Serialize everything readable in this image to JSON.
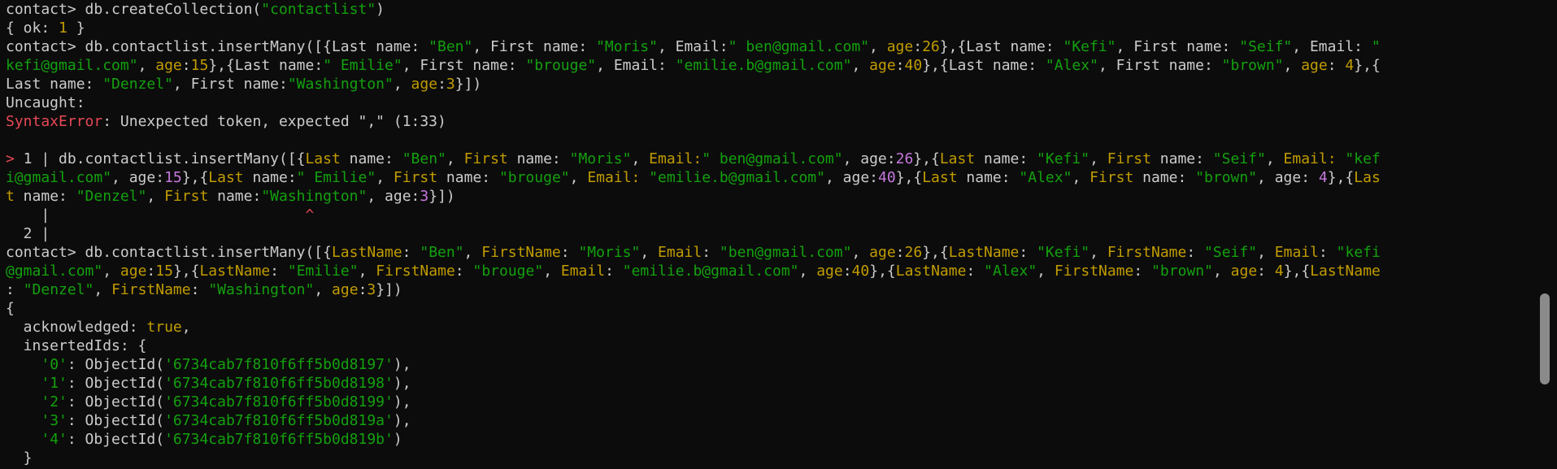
{
  "colors": {
    "background": "#0c0c0c",
    "default": "#cccccc",
    "string": "#13a10e",
    "number": "#c678dd",
    "keyword": "#c19c00",
    "error": "#e74856",
    "scrollbar": "#8a8a8a"
  },
  "lines": [
    [
      {
        "t": "contact> db.createCollection("
      },
      {
        "t": "\"contactlist\"",
        "c": "string"
      },
      {
        "t": ")"
      }
    ],
    [
      {
        "t": "{ ok: "
      },
      {
        "t": "1",
        "c": "keyword"
      },
      {
        "t": " }"
      }
    ],
    [
      {
        "t": "contact> db.contactlist.insertMany([{Last name: "
      },
      {
        "t": "\"Ben\"",
        "c": "string"
      },
      {
        "t": ", First name: "
      },
      {
        "t": "\"Moris\"",
        "c": "string"
      },
      {
        "t": ", Email:"
      },
      {
        "t": "\" ben@gmail.com\"",
        "c": "string"
      },
      {
        "t": ", "
      },
      {
        "t": "age",
        "c": "keyword"
      },
      {
        "t": ":"
      },
      {
        "t": "26",
        "c": "keyword"
      },
      {
        "t": "},{Last name: "
      },
      {
        "t": "\"Kefi\"",
        "c": "string"
      },
      {
        "t": ", First name: "
      },
      {
        "t": "\"Seif\"",
        "c": "string"
      },
      {
        "t": ", Email: "
      },
      {
        "t": "\"",
        "c": "string"
      }
    ],
    [
      {
        "t": "kefi@gmail.com\"",
        "c": "string"
      },
      {
        "t": ", "
      },
      {
        "t": "age",
        "c": "keyword"
      },
      {
        "t": ":"
      },
      {
        "t": "15",
        "c": "keyword"
      },
      {
        "t": "},{Last name:"
      },
      {
        "t": "\" Emilie\"",
        "c": "string"
      },
      {
        "t": ", First name: "
      },
      {
        "t": "\"brouge\"",
        "c": "string"
      },
      {
        "t": ", Email: "
      },
      {
        "t": "\"emilie.b@gmail.com\"",
        "c": "string"
      },
      {
        "t": ", "
      },
      {
        "t": "age",
        "c": "keyword"
      },
      {
        "t": ":"
      },
      {
        "t": "40",
        "c": "keyword"
      },
      {
        "t": "},{Last name: "
      },
      {
        "t": "\"Alex\"",
        "c": "string"
      },
      {
        "t": ", First name: "
      },
      {
        "t": "\"brown\"",
        "c": "string"
      },
      {
        "t": ", "
      },
      {
        "t": "age",
        "c": "keyword"
      },
      {
        "t": ": "
      },
      {
        "t": "4",
        "c": "keyword"
      },
      {
        "t": "},{"
      }
    ],
    [
      {
        "t": "Last name: "
      },
      {
        "t": "\"Denzel\"",
        "c": "string"
      },
      {
        "t": ", First name:"
      },
      {
        "t": "\"Washington\"",
        "c": "string"
      },
      {
        "t": ", "
      },
      {
        "t": "age",
        "c": "keyword"
      },
      {
        "t": ":"
      },
      {
        "t": "3",
        "c": "keyword"
      },
      {
        "t": "}])"
      }
    ],
    [
      {
        "t": "Uncaught:"
      }
    ],
    [
      {
        "t": "SyntaxError",
        "c": "error"
      },
      {
        "t": ": Unexpected token, expected \",\" (1:33)"
      }
    ],
    [],
    [
      {
        "t": ">",
        "c": "error"
      },
      {
        "t": " 1 | db.contactlist.insertMany([{"
      },
      {
        "t": "Last",
        "c": "keyword"
      },
      {
        "t": " name: "
      },
      {
        "t": "\"Ben\"",
        "c": "string"
      },
      {
        "t": ", "
      },
      {
        "t": "First",
        "c": "keyword"
      },
      {
        "t": " name: "
      },
      {
        "t": "\"Moris\"",
        "c": "string"
      },
      {
        "t": ", "
      },
      {
        "t": "Email:",
        "c": "keyword"
      },
      {
        "t": "\" ben@gmail.com\"",
        "c": "string"
      },
      {
        "t": ", age:"
      },
      {
        "t": "26",
        "c": "number"
      },
      {
        "t": "},{"
      },
      {
        "t": "Last",
        "c": "keyword"
      },
      {
        "t": " name: "
      },
      {
        "t": "\"Kefi\"",
        "c": "string"
      },
      {
        "t": ", "
      },
      {
        "t": "First",
        "c": "keyword"
      },
      {
        "t": " name: "
      },
      {
        "t": "\"Seif\"",
        "c": "string"
      },
      {
        "t": ", "
      },
      {
        "t": "Email:",
        "c": "keyword"
      },
      {
        "t": " "
      },
      {
        "t": "\"kef",
        "c": "string"
      }
    ],
    [
      {
        "t": "i@gmail.com\"",
        "c": "string"
      },
      {
        "t": ", age:"
      },
      {
        "t": "15",
        "c": "number"
      },
      {
        "t": "},{"
      },
      {
        "t": "Last",
        "c": "keyword"
      },
      {
        "t": " name:"
      },
      {
        "t": "\" Emilie\"",
        "c": "string"
      },
      {
        "t": ", "
      },
      {
        "t": "First",
        "c": "keyword"
      },
      {
        "t": " name: "
      },
      {
        "t": "\"brouge\"",
        "c": "string"
      },
      {
        "t": ", "
      },
      {
        "t": "Email:",
        "c": "keyword"
      },
      {
        "t": " "
      },
      {
        "t": "\"emilie.b@gmail.com\"",
        "c": "string"
      },
      {
        "t": ", age:"
      },
      {
        "t": "40",
        "c": "number"
      },
      {
        "t": "},{"
      },
      {
        "t": "Last",
        "c": "keyword"
      },
      {
        "t": " name: "
      },
      {
        "t": "\"Alex\"",
        "c": "string"
      },
      {
        "t": ", "
      },
      {
        "t": "First",
        "c": "keyword"
      },
      {
        "t": " name: "
      },
      {
        "t": "\"brown\"",
        "c": "string"
      },
      {
        "t": ", age: "
      },
      {
        "t": "4",
        "c": "number"
      },
      {
        "t": "},{"
      },
      {
        "t": "Las",
        "c": "keyword"
      }
    ],
    [
      {
        "t": "t",
        "c": "keyword"
      },
      {
        "t": " name: "
      },
      {
        "t": "\"Denzel\"",
        "c": "string"
      },
      {
        "t": ", "
      },
      {
        "t": "First",
        "c": "keyword"
      },
      {
        "t": " name:"
      },
      {
        "t": "\"Washington\"",
        "c": "string"
      },
      {
        "t": ", age:"
      },
      {
        "t": "3",
        "c": "number"
      },
      {
        "t": "}])"
      }
    ],
    [
      {
        "t": "    |                             "
      },
      {
        "t": "^",
        "c": "error"
      }
    ],
    [
      {
        "t": "  2 |"
      }
    ],
    [
      {
        "t": "contact> db.contactlist.insertMany([{"
      },
      {
        "t": "LastName",
        "c": "keyword"
      },
      {
        "t": ": "
      },
      {
        "t": "\"Ben\"",
        "c": "string"
      },
      {
        "t": ", "
      },
      {
        "t": "FirstName",
        "c": "keyword"
      },
      {
        "t": ": "
      },
      {
        "t": "\"Moris\"",
        "c": "string"
      },
      {
        "t": ", "
      },
      {
        "t": "Email",
        "c": "keyword"
      },
      {
        "t": ": "
      },
      {
        "t": "\"ben@gmail.com\"",
        "c": "string"
      },
      {
        "t": ", "
      },
      {
        "t": "age",
        "c": "keyword"
      },
      {
        "t": ":"
      },
      {
        "t": "26",
        "c": "keyword"
      },
      {
        "t": "},{"
      },
      {
        "t": "LastName",
        "c": "keyword"
      },
      {
        "t": ": "
      },
      {
        "t": "\"Kefi\"",
        "c": "string"
      },
      {
        "t": ", "
      },
      {
        "t": "FirstName",
        "c": "keyword"
      },
      {
        "t": ": "
      },
      {
        "t": "\"Seif\"",
        "c": "string"
      },
      {
        "t": ", "
      },
      {
        "t": "Email",
        "c": "keyword"
      },
      {
        "t": ": "
      },
      {
        "t": "\"kefi",
        "c": "string"
      }
    ],
    [
      {
        "t": "@gmail.com\"",
        "c": "string"
      },
      {
        "t": ", "
      },
      {
        "t": "age",
        "c": "keyword"
      },
      {
        "t": ":"
      },
      {
        "t": "15",
        "c": "keyword"
      },
      {
        "t": "},{"
      },
      {
        "t": "LastName",
        "c": "keyword"
      },
      {
        "t": ": "
      },
      {
        "t": "\"Emilie\"",
        "c": "string"
      },
      {
        "t": ", "
      },
      {
        "t": "FirstName",
        "c": "keyword"
      },
      {
        "t": ": "
      },
      {
        "t": "\"brouge\"",
        "c": "string"
      },
      {
        "t": ", "
      },
      {
        "t": "Email",
        "c": "keyword"
      },
      {
        "t": ": "
      },
      {
        "t": "\"emilie.b@gmail.com\"",
        "c": "string"
      },
      {
        "t": ", "
      },
      {
        "t": "age",
        "c": "keyword"
      },
      {
        "t": ":"
      },
      {
        "t": "40",
        "c": "keyword"
      },
      {
        "t": "},{"
      },
      {
        "t": "LastName",
        "c": "keyword"
      },
      {
        "t": ": "
      },
      {
        "t": "\"Alex\"",
        "c": "string"
      },
      {
        "t": ", "
      },
      {
        "t": "FirstName",
        "c": "keyword"
      },
      {
        "t": ": "
      },
      {
        "t": "\"brown\"",
        "c": "string"
      },
      {
        "t": ", "
      },
      {
        "t": "age",
        "c": "keyword"
      },
      {
        "t": ": "
      },
      {
        "t": "4",
        "c": "keyword"
      },
      {
        "t": "},{"
      },
      {
        "t": "LastName",
        "c": "keyword"
      }
    ],
    [
      {
        "t": ": "
      },
      {
        "t": "\"Denzel\"",
        "c": "string"
      },
      {
        "t": ", "
      },
      {
        "t": "FirstName",
        "c": "keyword"
      },
      {
        "t": ": "
      },
      {
        "t": "\"Washington\"",
        "c": "string"
      },
      {
        "t": ", "
      },
      {
        "t": "age",
        "c": "keyword"
      },
      {
        "t": ":"
      },
      {
        "t": "3",
        "c": "keyword"
      },
      {
        "t": "}])"
      }
    ],
    [
      {
        "t": "{"
      }
    ],
    [
      {
        "t": "  acknowledged: "
      },
      {
        "t": "true",
        "c": "keyword"
      },
      {
        "t": ","
      }
    ],
    [
      {
        "t": "  insertedIds: {"
      }
    ],
    [
      {
        "t": "    "
      },
      {
        "t": "'0'",
        "c": "string"
      },
      {
        "t": ": ObjectId("
      },
      {
        "t": "'6734cab7f810f6ff5b0d8197'",
        "c": "string"
      },
      {
        "t": "),"
      }
    ],
    [
      {
        "t": "    "
      },
      {
        "t": "'1'",
        "c": "string"
      },
      {
        "t": ": ObjectId("
      },
      {
        "t": "'6734cab7f810f6ff5b0d8198'",
        "c": "string"
      },
      {
        "t": "),"
      }
    ],
    [
      {
        "t": "    "
      },
      {
        "t": "'2'",
        "c": "string"
      },
      {
        "t": ": ObjectId("
      },
      {
        "t": "'6734cab7f810f6ff5b0d8199'",
        "c": "string"
      },
      {
        "t": "),"
      }
    ],
    [
      {
        "t": "    "
      },
      {
        "t": "'3'",
        "c": "string"
      },
      {
        "t": ": ObjectId("
      },
      {
        "t": "'6734cab7f810f6ff5b0d819a'",
        "c": "string"
      },
      {
        "t": "),"
      }
    ],
    [
      {
        "t": "    "
      },
      {
        "t": "'4'",
        "c": "string"
      },
      {
        "t": ": ObjectId("
      },
      {
        "t": "'6734cab7f810f6ff5b0d819b'",
        "c": "string"
      },
      {
        "t": ")"
      }
    ],
    [
      {
        "t": "  }"
      }
    ]
  ]
}
